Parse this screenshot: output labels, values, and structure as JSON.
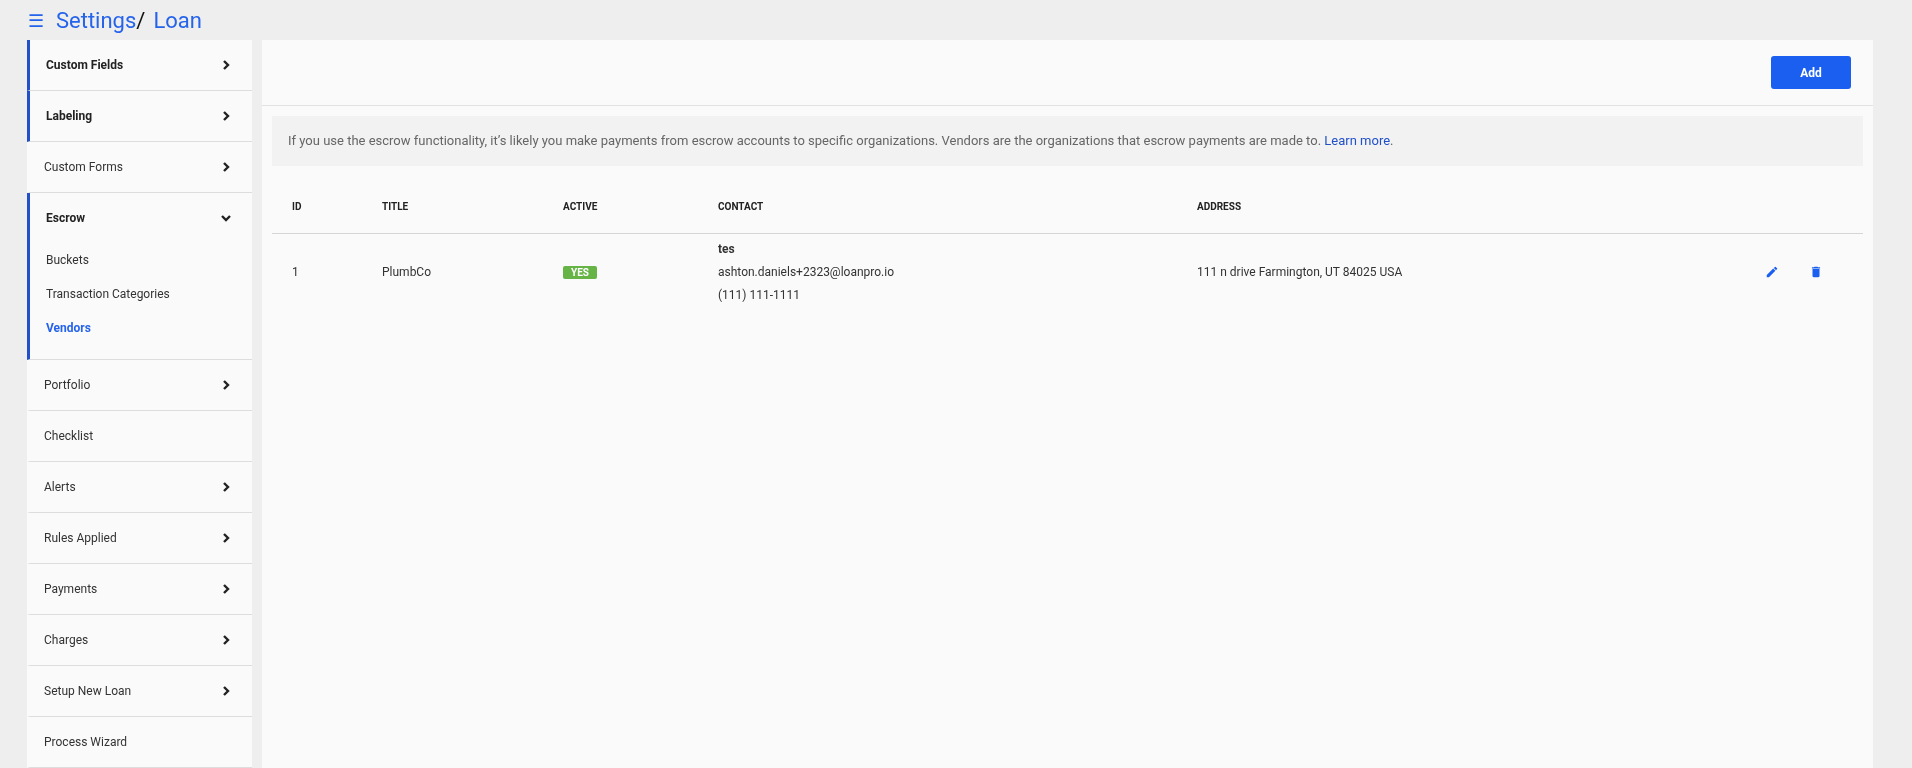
{
  "breadcrumb": {
    "menu_icon": "☰",
    "parts": [
      "Settings",
      "Loan"
    ],
    "separator": "/"
  },
  "sidebar": {
    "items": [
      {
        "label": "Custom Fields",
        "kind": "menu",
        "accented": true,
        "expanded": false
      },
      {
        "label": "Labeling",
        "kind": "menu",
        "accented": true,
        "expanded": false
      },
      {
        "label": "Custom Forms",
        "kind": "menu",
        "accented": false,
        "expanded": false
      },
      {
        "label": "Escrow",
        "kind": "menu",
        "accented": true,
        "expanded": true,
        "children": [
          {
            "label": "Buckets",
            "selected": false
          },
          {
            "label": "Transaction Categories",
            "selected": false
          },
          {
            "label": "Vendors",
            "selected": true
          }
        ]
      },
      {
        "label": "Portfolio",
        "kind": "menu",
        "accented": false,
        "expanded": false
      },
      {
        "label": "Checklist",
        "kind": "link",
        "accented": false
      },
      {
        "label": "Alerts",
        "kind": "menu",
        "accented": false,
        "expanded": false
      },
      {
        "label": "Rules Applied",
        "kind": "menu",
        "accented": false,
        "expanded": false
      },
      {
        "label": "Payments",
        "kind": "menu",
        "accented": false,
        "expanded": false
      },
      {
        "label": "Charges",
        "kind": "menu",
        "accented": false,
        "expanded": false
      },
      {
        "label": "Setup New Loan",
        "kind": "menu",
        "accented": false,
        "expanded": false
      },
      {
        "label": "Process Wizard",
        "kind": "link",
        "accented": false
      }
    ]
  },
  "toolbar": {
    "add_button": "Add"
  },
  "info": {
    "text": "If you use the escrow functionality, it’s likely you make payments from escrow accounts to specific organizations. Vendors are the organizations that escrow payments are made to.",
    "link": "Learn more",
    "end": "."
  },
  "table": {
    "columns": [
      "ID",
      "TITLE",
      "ACTIVE",
      "CONTACT",
      "ADDRESS"
    ],
    "rows": [
      {
        "id": "1",
        "title": "PlumbCo",
        "active": {
          "label": "YES",
          "on": true
        },
        "contact": {
          "name": "tes",
          "email": "ashton.daniels+2323@loanpro.io",
          "phone": "(111) 111-1111"
        },
        "address": "111 n drive Farmington, UT 84025 USA"
      }
    ]
  }
}
